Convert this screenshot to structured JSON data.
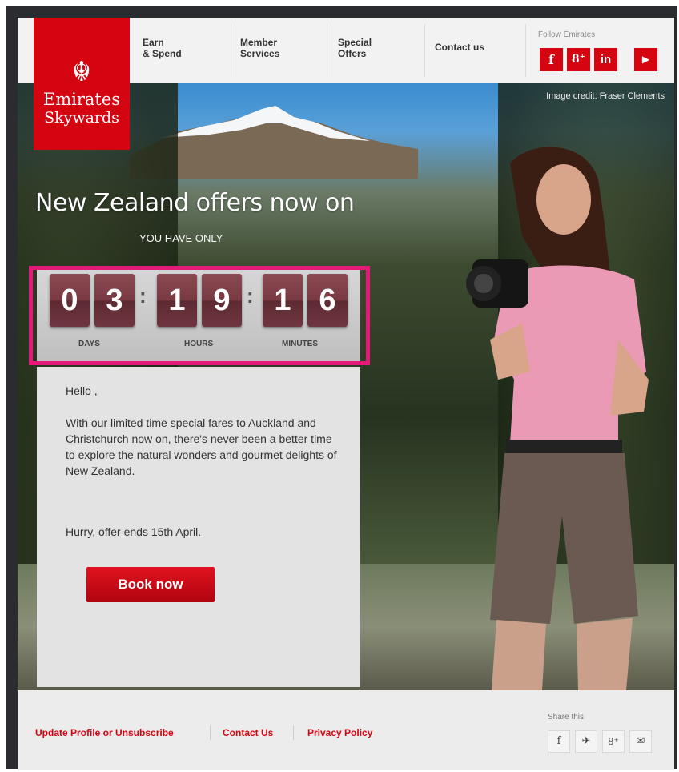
{
  "brand": {
    "line1": "Emirates",
    "line2": "Skywards",
    "glyph": "☬"
  },
  "nav": {
    "items": [
      {
        "l1": "Earn",
        "l2": "& Spend"
      },
      {
        "l1": "Member",
        "l2": "Services"
      },
      {
        "l1": "Special",
        "l2": "Offers"
      },
      {
        "l1": "Contact us",
        "l2": ""
      }
    ],
    "follow_label": "Follow Emirates",
    "social": [
      {
        "icon": "facebook-icon",
        "glyph": "f"
      },
      {
        "icon": "google-plus-icon",
        "glyph": "8⁺"
      },
      {
        "icon": "linkedin-icon",
        "glyph": "in"
      },
      {
        "icon": "youtube-icon",
        "glyph": "▶"
      }
    ]
  },
  "hero": {
    "credit": "Image credit: Fraser Clements",
    "headline": "New Zealand offers now on",
    "you_have": "YOU HAVE ONLY"
  },
  "countdown": {
    "days": [
      "0",
      "3"
    ],
    "hours": [
      "1",
      "9"
    ],
    "minutes": [
      "1",
      "6"
    ],
    "labels": {
      "days": "DAYS",
      "hours": "HOURS",
      "minutes": "MINUTES"
    }
  },
  "body": {
    "greeting": "Hello ,",
    "para1": "With our limited time special fares to Auckland and Christchurch now on, there's never been a better time to explore the natural wonders and gourmet delights of New Zealand.",
    "para2": "Hurry, offer ends 15th April.",
    "cta": "Book now"
  },
  "footer": {
    "links": [
      "Update Profile or Unsubscribe",
      "Contact Us",
      "Privacy Policy"
    ],
    "share_label": "Share this",
    "share": [
      {
        "icon": "facebook-icon",
        "glyph": "f"
      },
      {
        "icon": "twitter-icon",
        "glyph": "✈"
      },
      {
        "icon": "google-plus-icon",
        "glyph": "8⁺"
      },
      {
        "icon": "email-icon",
        "glyph": "✉"
      }
    ]
  },
  "colors": {
    "brand_red": "#d40511",
    "highlight_pink": "#e5197a",
    "flip_digit": "#7a3a44"
  }
}
